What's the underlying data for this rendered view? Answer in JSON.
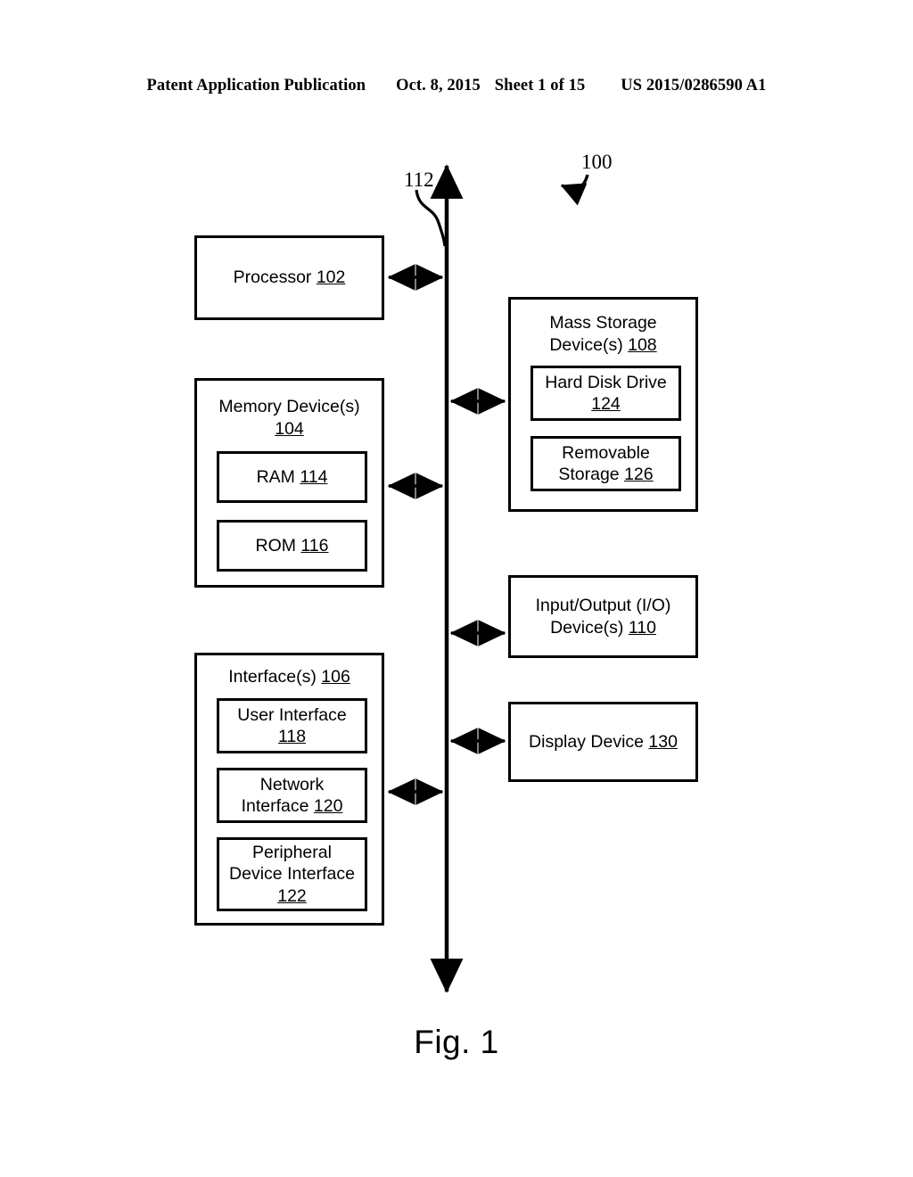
{
  "header": {
    "publication": "Patent Application Publication",
    "date": "Oct. 8, 2015",
    "sheet": "Sheet 1 of 15",
    "patent_number": "US 2015/0286590 A1"
  },
  "figure": {
    "caption": "Fig. 1",
    "system_ref": "100",
    "bus_ref": "112",
    "blocks": {
      "processor": {
        "title": "Processor ",
        "ref": "102"
      },
      "memory": {
        "title": "Memory Device(s)\n",
        "ref": "104",
        "children": [
          {
            "title": "RAM ",
            "ref": "114"
          },
          {
            "title": "ROM ",
            "ref": "116"
          }
        ]
      },
      "interfaces": {
        "title": "Interface(s) ",
        "ref": "106",
        "children": [
          {
            "title": "User Interface\n",
            "ref": "118"
          },
          {
            "title": "Network\nInterface ",
            "ref": "120"
          },
          {
            "title": "Peripheral\nDevice Interface\n",
            "ref": "122"
          }
        ]
      },
      "mass_storage": {
        "title": "Mass Storage\nDevice(s) ",
        "ref": "108",
        "children": [
          {
            "title": "Hard Disk Drive\n",
            "ref": "124"
          },
          {
            "title": "Removable\nStorage ",
            "ref": "126"
          }
        ]
      },
      "io": {
        "title": "Input/Output (I/O)\nDevice(s) ",
        "ref": "110"
      },
      "display": {
        "title": "Display Device ",
        "ref": "130"
      }
    }
  },
  "colors": {
    "ink": "#000000",
    "paper": "#ffffff"
  }
}
